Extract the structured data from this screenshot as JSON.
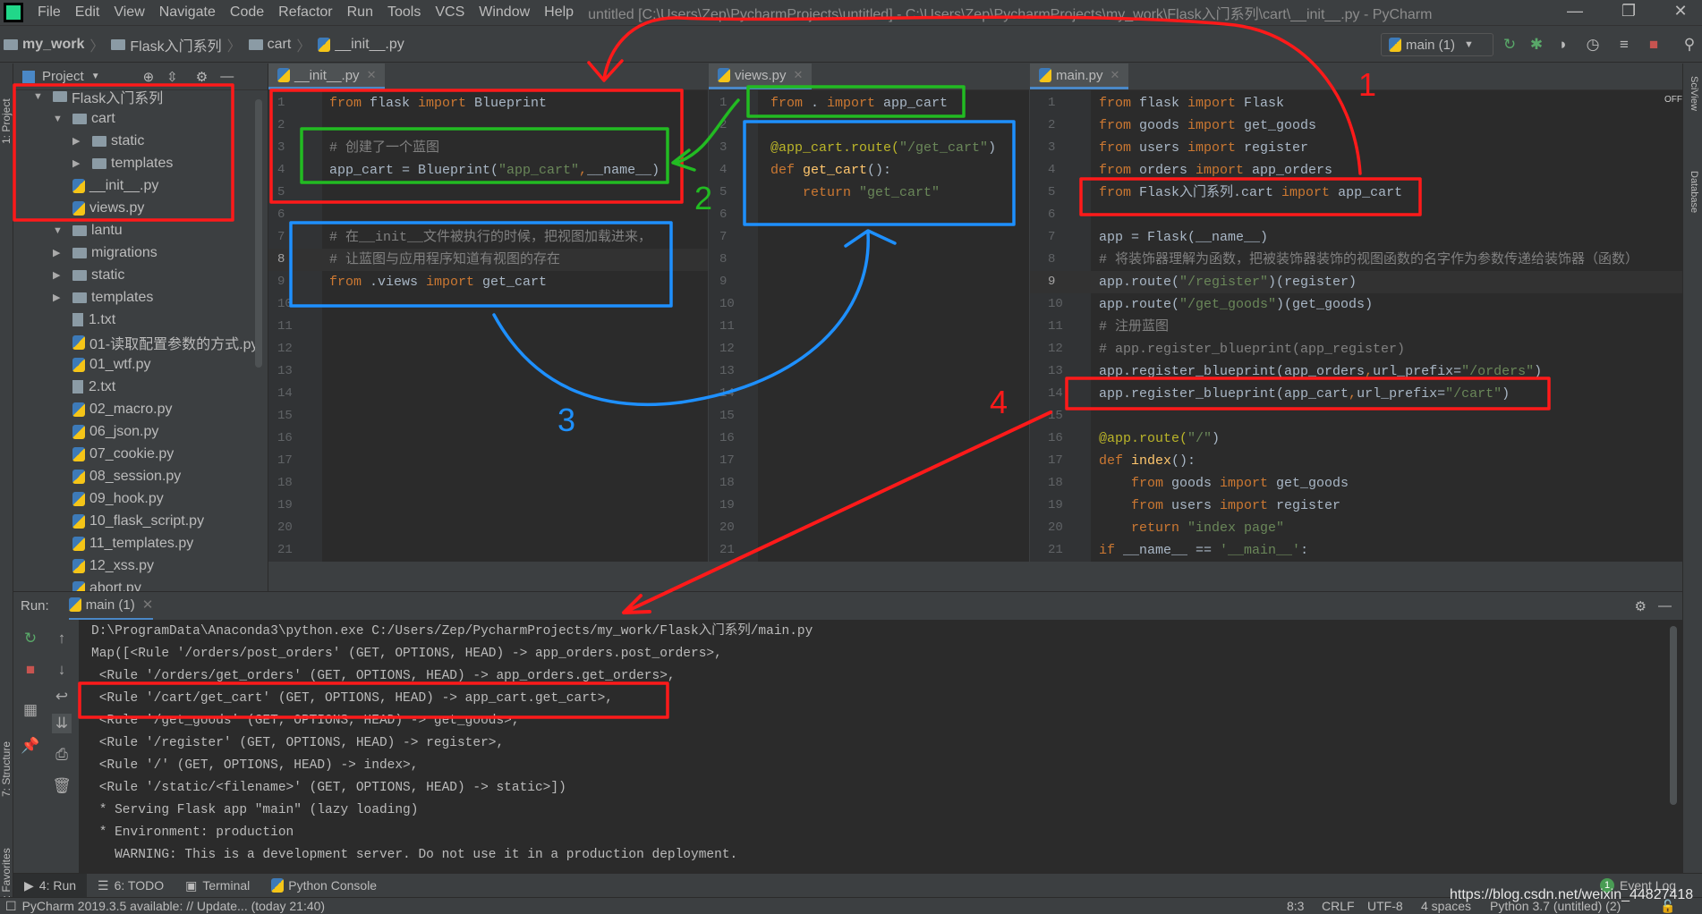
{
  "window": {
    "title": "untitled [C:\\Users\\Zep\\PycharmProjects\\untitled] - C:\\Users\\Zep\\PycharmProjects\\my_work\\Flask入门系列\\cart\\__init__.py - PyCharm",
    "menu": [
      "File",
      "Edit",
      "View",
      "Navigate",
      "Code",
      "Refactor",
      "Run",
      "Tools",
      "VCS",
      "Window",
      "Help"
    ]
  },
  "breadcrumb": [
    "my_work",
    "Flask入门系列",
    "cart",
    "__init__.py"
  ],
  "run_config": "main (1)",
  "project_panel": {
    "title": "Project",
    "side_label": "1: Project",
    "tree": [
      {
        "label": "Flask入门系列",
        "type": "folder",
        "depth": 0,
        "open": true
      },
      {
        "label": "cart",
        "type": "folder",
        "depth": 1,
        "open": true
      },
      {
        "label": "static",
        "type": "folder",
        "depth": 2
      },
      {
        "label": "templates",
        "type": "folder",
        "depth": 2
      },
      {
        "label": "__init__.py",
        "type": "py",
        "depth": 2
      },
      {
        "label": "views.py",
        "type": "py",
        "depth": 2
      },
      {
        "label": "lantu",
        "type": "folder",
        "depth": 1,
        "open": true
      },
      {
        "label": "migrations",
        "type": "folder",
        "depth": 1,
        "open": false
      },
      {
        "label": "static",
        "type": "folder",
        "depth": 1,
        "open": false
      },
      {
        "label": "templates",
        "type": "folder",
        "depth": 1,
        "open": false
      },
      {
        "label": "1.txt",
        "type": "txt",
        "depth": 2
      },
      {
        "label": "01-读取配置参数的方式.py",
        "type": "py",
        "depth": 2
      },
      {
        "label": "01_wtf.py",
        "type": "py",
        "depth": 2
      },
      {
        "label": "2.txt",
        "type": "txt",
        "depth": 2
      },
      {
        "label": "02_macro.py",
        "type": "py",
        "depth": 2
      },
      {
        "label": "06_json.py",
        "type": "py",
        "depth": 2
      },
      {
        "label": "07_cookie.py",
        "type": "py",
        "depth": 2
      },
      {
        "label": "08_session.py",
        "type": "py",
        "depth": 2
      },
      {
        "label": "09_hook.py",
        "type": "py",
        "depth": 2
      },
      {
        "label": "10_flask_script.py",
        "type": "py",
        "depth": 2
      },
      {
        "label": "11_templates.py",
        "type": "py",
        "depth": 2
      },
      {
        "label": "12_xss.py",
        "type": "py",
        "depth": 2
      },
      {
        "label": "abort.py",
        "type": "py",
        "depth": 2
      }
    ]
  },
  "editors": [
    {
      "tab": "__init__.py",
      "current_line": 8,
      "lines": [
        [
          [
            "from ",
            "kw"
          ],
          [
            "flask ",
            "df"
          ],
          [
            "import ",
            "kw"
          ],
          [
            "Blueprint",
            "df"
          ]
        ],
        [],
        [
          [
            "# 创建了一个蓝图",
            "cm"
          ]
        ],
        [
          [
            "app_cart = Blueprint(",
            "df"
          ],
          [
            "\"app_cart\"",
            "st"
          ],
          [
            ",",
            "kw"
          ],
          [
            "__name__)",
            "df"
          ]
        ],
        [],
        [],
        [
          [
            "# 在__init__文件被执行的时候，把视图加载进来，",
            "cm"
          ]
        ],
        [
          [
            "# 让蓝图与应用程序知道有视图的存在",
            "cm"
          ]
        ],
        [
          [
            "from ",
            "kw"
          ],
          [
            ".views ",
            "df"
          ],
          [
            "import ",
            "kw"
          ],
          [
            "get_cart",
            "df"
          ]
        ]
      ]
    },
    {
      "tab": "views.py",
      "lines": [
        [
          [
            "from ",
            "kw"
          ],
          [
            ". ",
            "df"
          ],
          [
            "import ",
            "kw"
          ],
          [
            "app_cart",
            "df"
          ]
        ],
        [],
        [
          [
            "@app_cart.route(",
            "dc"
          ],
          [
            "\"/get_cart\"",
            "st"
          ],
          [
            ")",
            "df"
          ]
        ],
        [
          [
            "def ",
            "kw"
          ],
          [
            "get_cart",
            "fn"
          ],
          [
            "():",
            "df"
          ]
        ],
        [
          [
            "    return ",
            "kw"
          ],
          [
            "\"get_cart\"",
            "st"
          ]
        ]
      ]
    },
    {
      "tab": "main.py",
      "current_line": 9,
      "lines": [
        [
          [
            "from ",
            "kw"
          ],
          [
            "flask ",
            "df"
          ],
          [
            "import ",
            "kw"
          ],
          [
            "Flask",
            "df"
          ]
        ],
        [
          [
            "from ",
            "kw"
          ],
          [
            "goods ",
            "df"
          ],
          [
            "import ",
            "kw"
          ],
          [
            "get_goods",
            "df"
          ]
        ],
        [
          [
            "from ",
            "kw"
          ],
          [
            "users ",
            "df"
          ],
          [
            "import ",
            "kw"
          ],
          [
            "register",
            "df"
          ]
        ],
        [
          [
            "from ",
            "kw"
          ],
          [
            "orders ",
            "df"
          ],
          [
            "import ",
            "kw"
          ],
          [
            "app_orders",
            "df"
          ]
        ],
        [
          [
            "from ",
            "kw"
          ],
          [
            "Flask入门系列.cart ",
            "df"
          ],
          [
            "import ",
            "kw"
          ],
          [
            "app_cart",
            "df"
          ]
        ],
        [],
        [
          [
            "app = Flask(__name__)",
            "df"
          ]
        ],
        [
          [
            "# 将装饰器理解为函数，把被装饰器装饰的视图函数的名字作为参数传递给装饰器（函数）",
            "cm"
          ]
        ],
        [
          [
            "app.route(",
            "df"
          ],
          [
            "\"/register\"",
            "st"
          ],
          [
            ")(register)",
            "df"
          ]
        ],
        [
          [
            "app.route(",
            "df"
          ],
          [
            "\"/get_goods\"",
            "st"
          ],
          [
            ")(get_goods)",
            "df"
          ]
        ],
        [
          [
            "# 注册蓝图",
            "cm"
          ]
        ],
        [
          [
            "# app.register_blueprint(app_register)",
            "cm"
          ]
        ],
        [
          [
            "app.register_blueprint(app_orders",
            "df"
          ],
          [
            ",",
            "kw"
          ],
          [
            "url_prefix=",
            "df"
          ],
          [
            "\"/orders\"",
            "st"
          ],
          [
            ")",
            "df"
          ]
        ],
        [
          [
            "app.register_blueprint(app_cart",
            "df"
          ],
          [
            ",",
            "kw"
          ],
          [
            "url_prefix=",
            "df"
          ],
          [
            "\"/cart\"",
            "st"
          ],
          [
            ")",
            "df"
          ]
        ],
        [],
        [
          [
            "@app.route(",
            "dc"
          ],
          [
            "\"/\"",
            "st"
          ],
          [
            ")",
            "df"
          ]
        ],
        [
          [
            "def ",
            "kw"
          ],
          [
            "index",
            "fn"
          ],
          [
            "():",
            "df"
          ]
        ],
        [
          [
            "    from ",
            "kw"
          ],
          [
            "goods ",
            "df"
          ],
          [
            "import ",
            "kw"
          ],
          [
            "get_goods",
            "df"
          ]
        ],
        [
          [
            "    from ",
            "kw"
          ],
          [
            "users ",
            "df"
          ],
          [
            "import ",
            "kw"
          ],
          [
            "register",
            "df"
          ]
        ],
        [
          [
            "    return ",
            "kw"
          ],
          [
            "\"index page\"",
            "st"
          ]
        ],
        [
          [
            "if ",
            "kw"
          ],
          [
            "__name__ == ",
            "df"
          ],
          [
            "'__main__'",
            "st"
          ],
          [
            ":",
            "df"
          ]
        ]
      ]
    }
  ],
  "run_panel": {
    "label": "Run:",
    "tab": "main (1)",
    "output": [
      "D:\\ProgramData\\Anaconda3\\python.exe C:/Users/Zep/PycharmProjects/my_work/Flask入门系列/main.py",
      "Map([<Rule '/orders/post_orders' (GET, OPTIONS, HEAD) -> app_orders.post_orders>,",
      " <Rule '/orders/get_orders' (GET, OPTIONS, HEAD) -> app_orders.get_orders>,",
      " <Rule '/cart/get_cart' (GET, OPTIONS, HEAD) -> app_cart.get_cart>,",
      " <Rule '/get_goods' (GET, OPTIONS, HEAD) -> get_goods>,",
      " <Rule '/register' (GET, OPTIONS, HEAD) -> register>,",
      " <Rule '/' (GET, OPTIONS, HEAD) -> index>,",
      " <Rule '/static/<filename>' (GET, OPTIONS, HEAD) -> static>])",
      " * Serving Flask app \"main\" (lazy loading)",
      " * Environment: production",
      "   WARNING: This is a development server. Do not use it in a production deployment."
    ]
  },
  "tool_windows": [
    "4: Run",
    "6: TODO",
    "Terminal",
    "Python Console"
  ],
  "side_labels": {
    "structure": "7: Structure",
    "favorites": "2: Favorites",
    "sciview": "SciView",
    "database": "Database",
    "off": "OFF"
  },
  "event_log": {
    "count": "1",
    "label": "Event Log"
  },
  "status_bar": {
    "message": "PyCharm 2019.3.5 available: // Update... (today 21:40)",
    "position": "8:3",
    "line_sep": "CRLF",
    "encoding": "UTF-8",
    "indent": "4 spaces",
    "interpreter": "Python 3.7 (untitled) (2)"
  },
  "watermark": "https://blog.csdn.net/weixin_44827418",
  "annotations": {
    "n1": "1",
    "n2": "2",
    "n3": "3",
    "n4": "4",
    "red": "#ff1a1a",
    "green": "#22bb22",
    "blue": "#1e90ff"
  },
  "colors": {
    "keyword": "#cc7832",
    "string": "#6a8759",
    "comment": "#808080",
    "decorator": "#bbb529",
    "editor_bg": "#2b2b2b",
    "panel_bg": "#3c3f41"
  }
}
